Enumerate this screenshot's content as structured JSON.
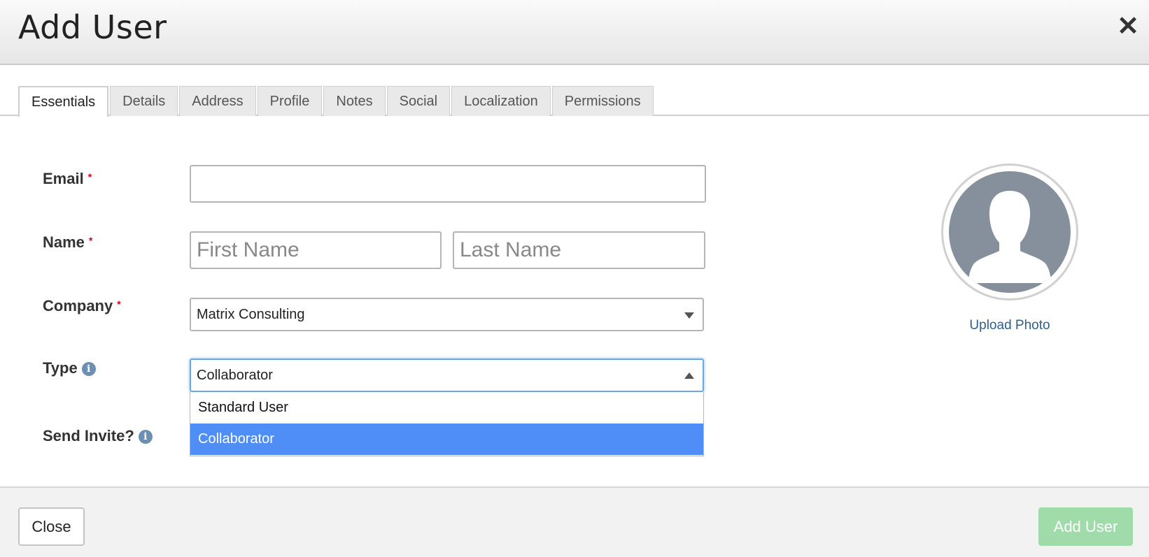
{
  "header": {
    "title": "Add User",
    "close_icon": "close-icon"
  },
  "tabs": [
    {
      "label": "Essentials",
      "active": true
    },
    {
      "label": "Details"
    },
    {
      "label": "Address"
    },
    {
      "label": "Profile"
    },
    {
      "label": "Notes"
    },
    {
      "label": "Social"
    },
    {
      "label": "Localization"
    },
    {
      "label": "Permissions"
    }
  ],
  "form": {
    "email": {
      "label": "Email",
      "required_mark": "*",
      "value": ""
    },
    "name": {
      "label": "Name",
      "required_mark": "*",
      "first_placeholder": "First Name",
      "last_placeholder": "Last Name"
    },
    "company": {
      "label": "Company",
      "required_mark": "*",
      "value": "Matrix Consulting"
    },
    "type": {
      "label": "Type",
      "value": "Collaborator",
      "options": [
        {
          "label": "Standard User"
        },
        {
          "label": "Collaborator",
          "selected": true
        }
      ]
    },
    "send_invite": {
      "label": "Send Invite?"
    }
  },
  "avatar": {
    "upload_label": "Upload Photo"
  },
  "footer": {
    "close_label": "Close",
    "add_label": "Add User"
  },
  "colors": {
    "accent": "#4f8ef7",
    "required": "#d0021b",
    "add_button": "#9fdcaa",
    "link": "#2b5f8f"
  }
}
